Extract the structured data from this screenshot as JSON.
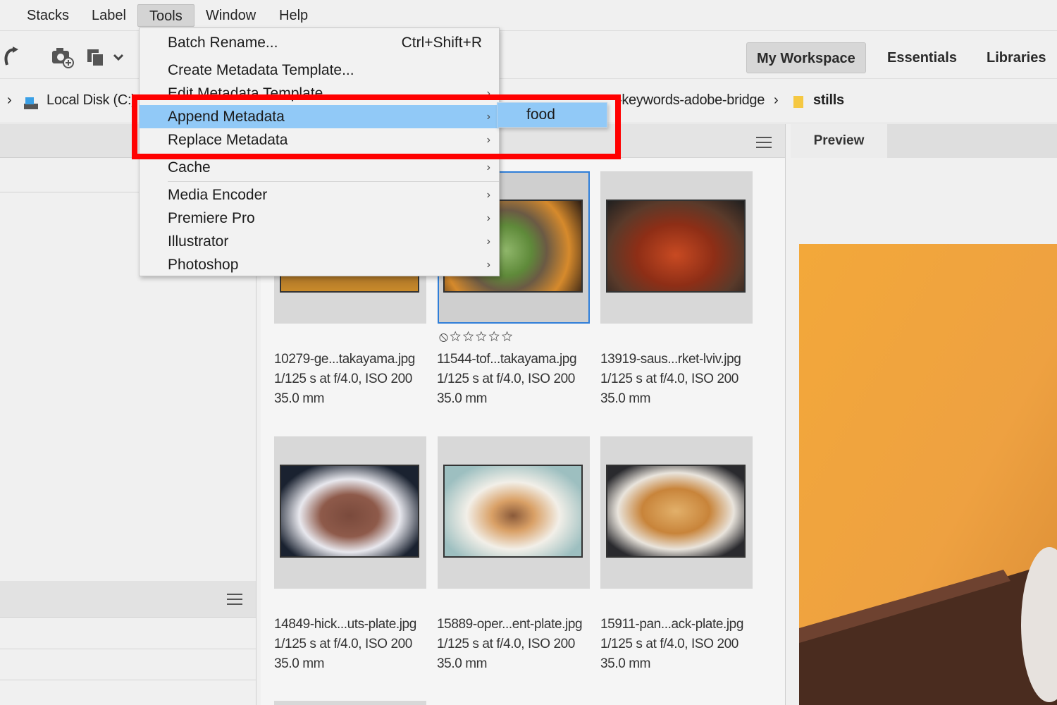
{
  "menubar": {
    "items": [
      "Stacks",
      "Label",
      "Tools",
      "Window",
      "Help"
    ],
    "active": "Tools"
  },
  "workspaces": {
    "items": [
      "My Workspace",
      "Essentials",
      "Libraries"
    ],
    "active": "My Workspace"
  },
  "path": {
    "drive": "Local Disk (C:)",
    "folder": "-keywords-adobe-bridge",
    "current": "stills"
  },
  "tools_menu": {
    "items": [
      {
        "label": "Batch Rename...",
        "shortcut": "Ctrl+Shift+R",
        "submenu": false
      },
      {
        "label": "Create Metadata Template...",
        "shortcut": "",
        "submenu": false
      },
      {
        "label": "Edit Metadata Template",
        "shortcut": "",
        "submenu": true
      },
      {
        "label": "Append Metadata",
        "shortcut": "",
        "submenu": true,
        "highlighted": true
      },
      {
        "label": "Replace Metadata",
        "shortcut": "",
        "submenu": true
      },
      {
        "label": "Cache",
        "shortcut": "",
        "submenu": true
      },
      {
        "label": "Media Encoder",
        "shortcut": "",
        "submenu": true
      },
      {
        "label": "Premiere Pro",
        "shortcut": "",
        "submenu": true
      },
      {
        "label": "Illustrator",
        "shortcut": "",
        "submenu": true
      },
      {
        "label": "Photoshop",
        "shortcut": "",
        "submenu": true
      }
    ],
    "submenu_item": "food"
  },
  "preview": {
    "tab": "Preview"
  },
  "thumbnails": [
    {
      "name": "10279-ge...takayama.jpg",
      "exposure": "1/125 s at f/4.0, ISO 200",
      "focal": "35.0 mm"
    },
    {
      "name": "11544-tof...takayama.jpg",
      "exposure": "1/125 s at f/4.0, ISO 200",
      "focal": "35.0 mm",
      "selected": true,
      "rating": "⦸☆☆☆☆☆"
    },
    {
      "name": "13919-saus...rket-lviv.jpg",
      "exposure": "1/125 s at f/4.0, ISO 200",
      "focal": "35.0 mm"
    },
    {
      "name": "14849-hick...uts-plate.jpg",
      "exposure": "1/125 s at f/4.0, ISO 200",
      "focal": "35.0 mm"
    },
    {
      "name": "15889-oper...ent-plate.jpg",
      "exposure": "1/125 s at f/4.0, ISO 200",
      "focal": "35.0 mm"
    },
    {
      "name": "15911-pan...ack-plate.jpg",
      "exposure": "1/125 s at f/4.0, ISO 200",
      "focal": "35.0 mm"
    }
  ],
  "colors": {
    "menu_highlight": "#91c9f7",
    "selection_border": "#2f7ed8",
    "annotation_box": "#ff0000"
  }
}
